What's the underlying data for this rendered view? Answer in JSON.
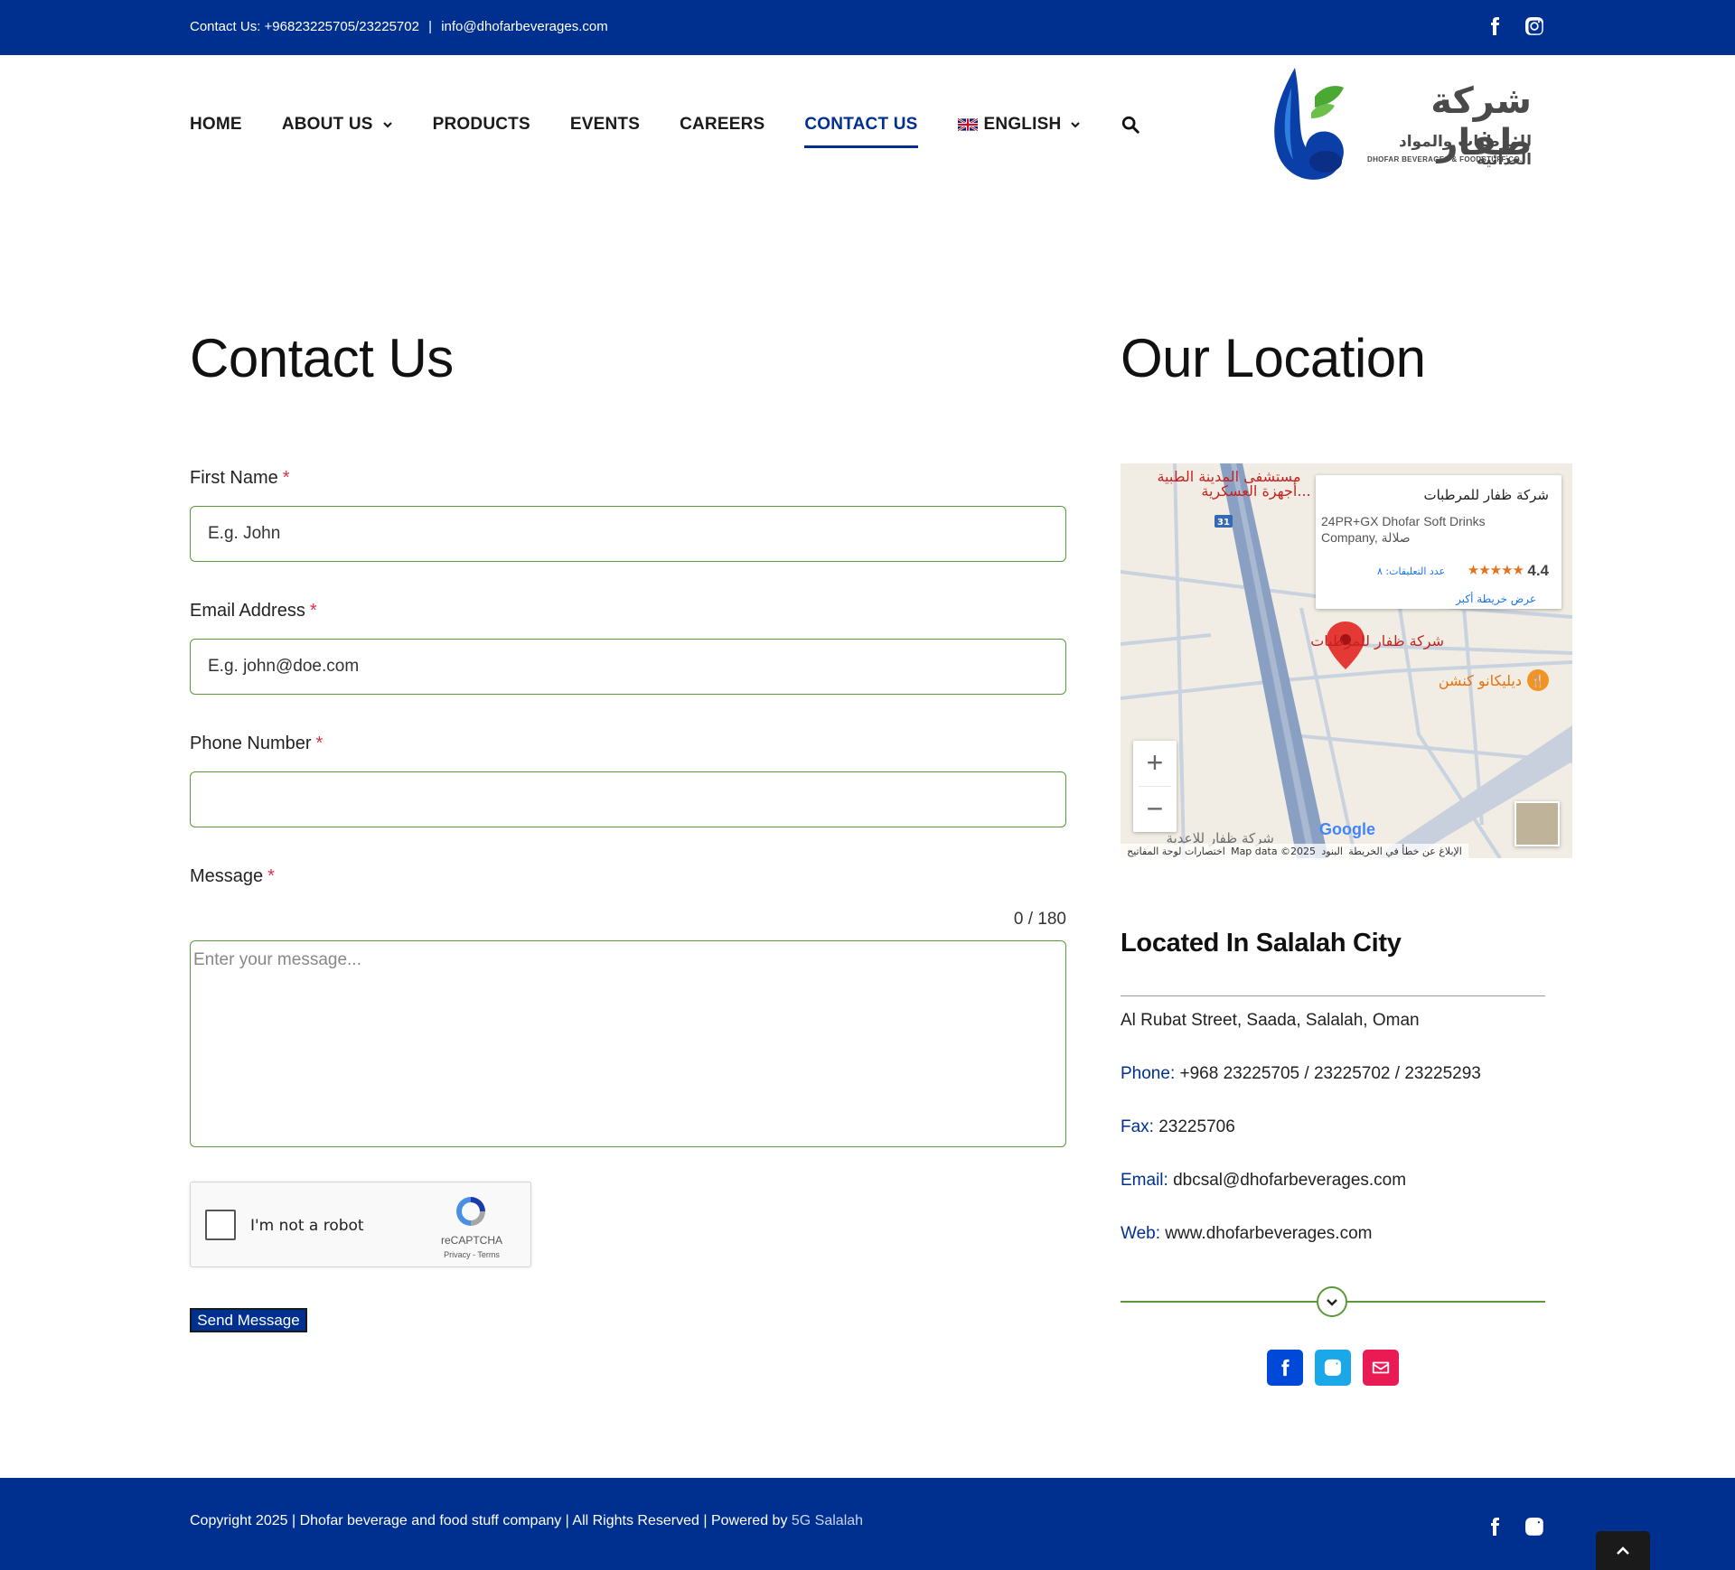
{
  "topbar": {
    "contact_text": "Contact Us: +96823225705/23225702",
    "separator": "|",
    "email": "info@dhofarbeverages.com",
    "social_icons": [
      "facebook-icon",
      "instagram-icon"
    ]
  },
  "nav": {
    "items": [
      {
        "label": "HOME",
        "active": false
      },
      {
        "label": "ABOUT US",
        "active": false,
        "dropdown": true
      },
      {
        "label": "PRODUCTS",
        "active": false
      },
      {
        "label": "EVENTS",
        "active": false
      },
      {
        "label": "CAREERS",
        "active": false
      },
      {
        "label": "CONTACT US",
        "active": true
      }
    ],
    "language": "ENGLISH",
    "search_icon": "search-icon"
  },
  "logo": {
    "arabic_name": "شركة ظفار",
    "arabic_sub": "للمرطبات والمواد الغذائية",
    "english_sub": "DHOFAR BEVERAGES & FOODSTUFF CO."
  },
  "contact": {
    "title": "Contact Us",
    "fields": {
      "first_name": {
        "label": "First Name",
        "required": "*",
        "placeholder": "E.g. John",
        "value": ""
      },
      "email": {
        "label": "Email Address",
        "required": "*",
        "placeholder": "E.g. john@doe.com",
        "value": ""
      },
      "phone": {
        "label": "Phone Number",
        "required": "*",
        "placeholder": "",
        "value": ""
      },
      "message": {
        "label": "Message",
        "required": "*",
        "placeholder": "Enter your message...",
        "counter": "0 / 180"
      }
    },
    "recaptcha": {
      "label": "I'm not a robot",
      "brand": "reCAPTCHA",
      "terms": "Privacy - Terms"
    },
    "submit_label": "Send Message"
  },
  "location": {
    "title": "Our Location",
    "map": {
      "place_name": "شركة ظفار للمرطبات",
      "address": "24PR+GX Dhofar Soft Drinks Company, صلالة",
      "rating": "4.4",
      "stars": "★★★★★",
      "reviews": "عدد التعليقات: ٨",
      "view_larger": "عرض خريطة أكبر",
      "pin_label": "شركة ظفار للمرطبات",
      "restaurant_label": "ديليكانو كنشن",
      "hospital_label": "مستشفى المدينة الطبية",
      "hospital_label_2": "أجهزة العسكرية...",
      "road_number": "31",
      "bottom_label": "شركة ظفار للاعدية",
      "attribution": [
        "اختصارات لوحة المفاتيح",
        "Map data ©2025",
        "البنود",
        "الإبلاغ عن خطأ في الخريطة"
      ],
      "google": "Google",
      "zoom_in": "+",
      "zoom_out": "−"
    },
    "heading": "Located In Salalah City",
    "address": "Al Rubat Street, Saada, Salalah, Oman",
    "phone_label": "Phone:",
    "phone": "+968 23225705 / 23225702 / 23225293",
    "fax_label": "Fax:",
    "fax": "23225706",
    "email_label": "Email:",
    "email": "dbcsal@dhofarbeverages.com",
    "web_label": "Web:",
    "web": "www.dhofarbeverages.com",
    "social": [
      {
        "icon": "facebook-icon",
        "color": "#0048d8"
      },
      {
        "icon": "instagram-icon",
        "color": "#1aa8e8"
      },
      {
        "icon": "envelope-icon",
        "color": "#ea1a54"
      }
    ]
  },
  "footer": {
    "copyright": "Copyright 2025 | Dhofar beverage and food stuff company | All Rights Reserved | Powered by ",
    "powered_by": "5G Salalah"
  },
  "colors": {
    "brand_blue": "#00308f",
    "field_border": "#5a9a3a",
    "required": "#e0304a"
  }
}
